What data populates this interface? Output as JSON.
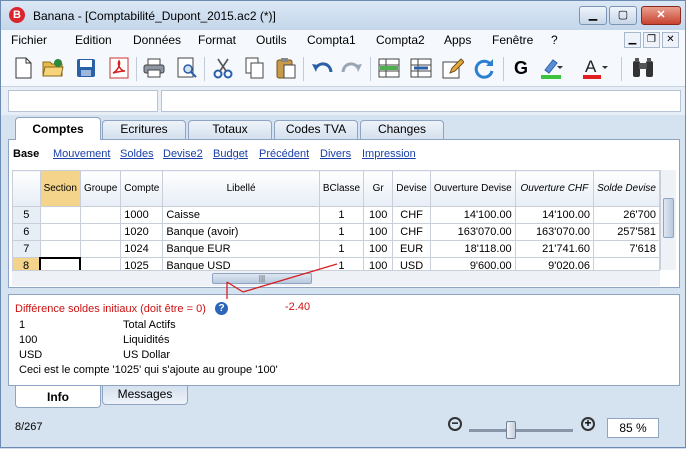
{
  "window": {
    "title": "Banana - [Comptabilité_Dupont_2015.ac2 (*)]",
    "app_icon_letter": "B"
  },
  "menu": [
    "Fichier",
    "Edition",
    "Données",
    "Format",
    "Outils",
    "Compta1",
    "Compta2",
    "Apps",
    "Fenêtre",
    "?"
  ],
  "toolbar": {
    "icons": [
      "new-icon",
      "open-icon",
      "save-icon",
      "pdf-icon",
      "print-icon",
      "preview-icon",
      "cut-icon",
      "copy-icon",
      "paste-icon",
      "undo-icon",
      "redo-icon",
      "insert-row-icon",
      "delete-row-icon",
      "edit-icon",
      "refresh-icon",
      "bold-icon",
      "highlight-icon",
      "font-color-icon",
      "binoculars-icon"
    ],
    "bold_label": "G",
    "font_color_label": "A"
  },
  "tabs": [
    "Comptes",
    "Ecritures",
    "Totaux",
    "Codes TVA",
    "Changes"
  ],
  "views": [
    "Base",
    "Mouvement",
    "Soldes",
    "Devise2",
    "Budget",
    "Précédent",
    "Divers",
    "Impression"
  ],
  "table": {
    "columns": [
      "Section",
      "Groupe",
      "Compte",
      "Libellé",
      "BClasse",
      "Gr",
      "Devise",
      "Ouverture Devise",
      "Ouverture CHF",
      "Solde Devise"
    ],
    "rows": [
      {
        "num": "5",
        "section": "",
        "groupe": "",
        "compte": "1000",
        "libelle": "Caisse",
        "bclasse": "1",
        "gr": "100",
        "devise": "CHF",
        "ouv_devise": "14'100.00",
        "ouv_chf": "14'100.00",
        "solde_devise": "26'700"
      },
      {
        "num": "6",
        "section": "",
        "groupe": "",
        "compte": "1020",
        "libelle": "Banque (avoir)",
        "bclasse": "1",
        "gr": "100",
        "devise": "CHF",
        "ouv_devise": "163'070.00",
        "ouv_chf": "163'070.00",
        "solde_devise": "257'581"
      },
      {
        "num": "7",
        "section": "",
        "groupe": "",
        "compte": "1024",
        "libelle": "Banque EUR",
        "bclasse": "1",
        "gr": "100",
        "devise": "EUR",
        "ouv_devise": "18'118.00",
        "ouv_chf": "21'741.60",
        "solde_devise": "7'618"
      },
      {
        "num": "8",
        "section": "",
        "groupe": "",
        "compte": "1025",
        "libelle": "Banque USD",
        "bclasse": "1",
        "gr": "100",
        "devise": "USD",
        "ouv_devise": "9'600.00",
        "ouv_chf": "9'020.06",
        "solde_devise": ""
      }
    ]
  },
  "hscroll_thumb_label": "|||",
  "info": {
    "diff_label": "Différence soldes initiaux (doit être = 0)",
    "diff_value": "-2.40",
    "help_label": "?",
    "lines": [
      {
        "code": "1",
        "text": "Total Actifs"
      },
      {
        "code": "100",
        "text": "Liquidités"
      },
      {
        "code": "USD",
        "text": "US Dollar"
      }
    ],
    "message": "Ceci est le compte '1025' qui s'ajoute au groupe '100'"
  },
  "bottom_tabs": [
    "Info",
    "Messages"
  ],
  "status": {
    "position": "8/267",
    "zoom": "85 %",
    "zoom_level": 0.4
  },
  "colors": {
    "accent_red": "#cc1111",
    "selected_header": "#f3d48a",
    "link_blue": "#1a3fa8"
  }
}
